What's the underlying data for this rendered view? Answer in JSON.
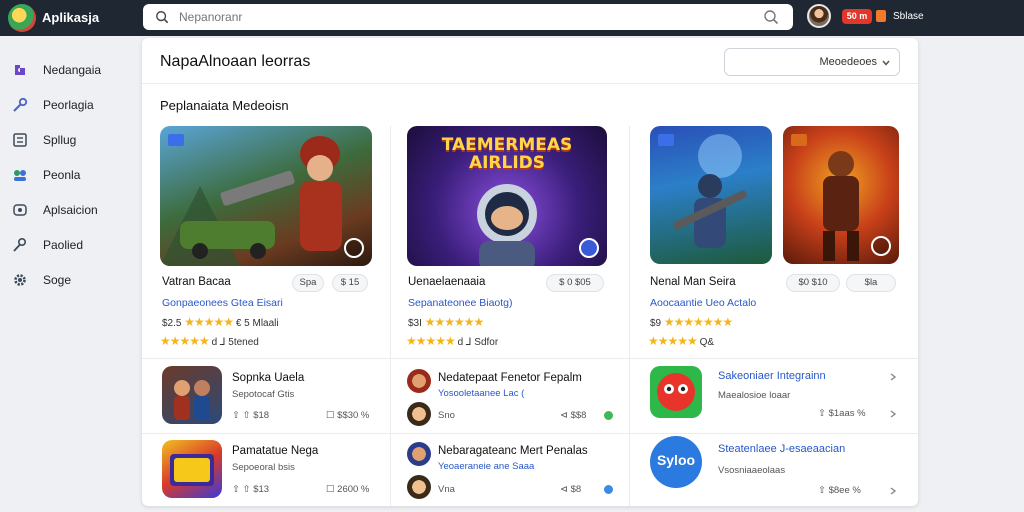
{
  "topbar": {
    "app_title": "Aplikasja",
    "search_placeholder": "Nepanoranr",
    "badge": "50 m",
    "user_name": "Sblase"
  },
  "sidebar": {
    "items": [
      {
        "label": "Nedangaia",
        "icon": "puzzle-icon"
      },
      {
        "label": "Peorlagia",
        "icon": "key-icon"
      },
      {
        "label": "Spllug",
        "icon": "list-icon"
      },
      {
        "label": "Peonla",
        "icon": "users-icon"
      },
      {
        "label": "Aplsaicion",
        "icon": "apps-icon"
      },
      {
        "label": "Paolied",
        "icon": "pin-icon"
      },
      {
        "label": "Soge",
        "icon": "gear-icon"
      }
    ]
  },
  "main": {
    "title": "NapaAlnoaan leorras",
    "dropdown_label": "Meoedeoes",
    "section_title": "Peplanaiata Medeoisn",
    "featured": [
      {
        "title": "Vatran Bacaa",
        "pills": [
          "Spa",
          "$ 15"
        ],
        "subtitle": "Gonpaeonees Gtea Eisari",
        "rating_line1": "$2.5 ★★★★★ € 5 Mlaali",
        "stars1": "★★★★★",
        "rating_line1_prefix": "$2.5",
        "rating_line1_suffix": "€ 5 Mlaali",
        "stars2": "★★★★★",
        "rating_line2_suffix": "d  ⅃ 5tened"
      },
      {
        "title": "Uenaelaenaaia",
        "pills": [
          "$ 0 $05"
        ],
        "art_text": "TAEMERMEAS AIRLIDS",
        "subtitle": "Sepanateonee Biaotg)",
        "rating_line1_prefix": "$3I",
        "stars1": "★★★★★★",
        "rating_line1_suffix": "",
        "stars2": "★★★★★",
        "rating_line2_suffix": "d  ⅃  Sdfor"
      },
      {
        "title": "Nenal Man Seira",
        "pills": [
          "$0 $10",
          "$la"
        ],
        "subtitle": "Aoocaantie Ueo Actalo",
        "rating_line1_prefix": "$9",
        "stars1": "★★★★★★★",
        "rating_line1_suffix": "",
        "stars2": "★★★★★",
        "rating_line2_suffix": "Q&"
      }
    ],
    "list_col1": [
      {
        "title": "Sopnka Uaela",
        "sub": "Sepotocaf Gtis",
        "meta_left": "⇧ ⇧ $18",
        "meta_right": "☐ $$30 %"
      },
      {
        "title": "Pamatatue Nega",
        "sub": "Sepoeoral bsis",
        "meta_left": "⇧ ⇧ $13",
        "meta_right": "☐ 2600 %"
      }
    ],
    "list_col2": [
      {
        "title": "Nedatepaat Fenetor Fepalm",
        "sub": "Yosooletaanee Lac (",
        "meta_left": "Sno",
        "meta_right": "⊲ $$8"
      },
      {
        "title": "Nebaragateanc Mert Penalas",
        "sub": "Yeoaeraneie ane Saaa",
        "meta_left": "Vna",
        "meta_right": "⊲ $8"
      }
    ],
    "list_col3": [
      {
        "title": "Sakeoniaer Integrainn",
        "sub": "Maealosioe loaar",
        "meta": "⇧ $1aas %"
      },
      {
        "title": "Steatenlaee J-esaeaacian",
        "sub": "Vsosniaaeolaas",
        "logo_text": "Syloo",
        "meta": "⇧ $8ee %"
      }
    ]
  }
}
